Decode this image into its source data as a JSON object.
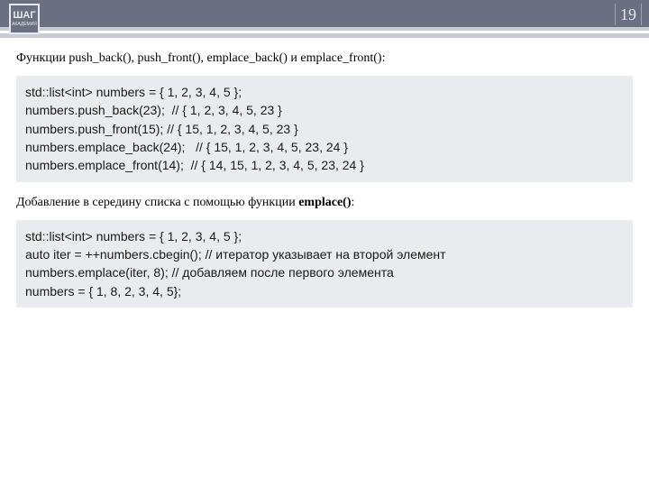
{
  "header": {
    "page_number": "19",
    "logo_text": "ШАГ",
    "logo_sub": "АКАДЕМИЯ"
  },
  "para1": "Функции push_back(), push_front(), emplace_back() и emplace_front():",
  "code1": "std::list<int> numbers = { 1, 2, 3, 4, 5 };\nnumbers.push_back(23);  // { 1, 2, 3, 4, 5, 23 }\nnumbers.push_front(15); // { 15, 1, 2, 3, 4, 5, 23 }\nnumbers.emplace_back(24);   // { 15, 1, 2, 3, 4, 5, 23, 24 }\nnumbers.emplace_front(14);  // { 14, 15, 1, 2, 3, 4, 5, 23, 24 }",
  "para2_pre": "Добавление в середину списка с помощью функции ",
  "para2_bold": "emplace()",
  "para2_post": ":",
  "code2": "std::list<int> numbers = { 1, 2, 3, 4, 5 };\nauto iter = ++numbers.cbegin(); // итератор указывает на второй элемент\nnumbers.emplace(iter, 8); // добавляем после первого элемента\nnumbers = { 1, 8, 2, 3, 4, 5};"
}
